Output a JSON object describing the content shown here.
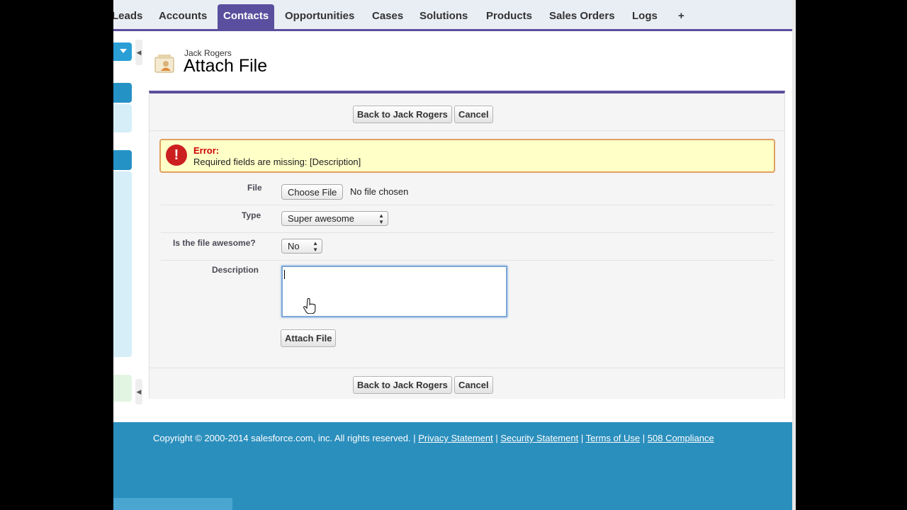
{
  "tabs": [
    {
      "label": "Leads",
      "active": false
    },
    {
      "label": "Accounts",
      "active": false
    },
    {
      "label": "Contacts",
      "active": true
    },
    {
      "label": "Opportunities",
      "active": false
    },
    {
      "label": "Cases",
      "active": false
    },
    {
      "label": "Solutions",
      "active": false
    },
    {
      "label": "Products",
      "active": false
    },
    {
      "label": "Sales Orders",
      "active": false
    },
    {
      "label": "Logs",
      "active": false
    },
    {
      "label": "+",
      "active": false
    }
  ],
  "header": {
    "record_name": "Jack Rogers",
    "title": "Attach File"
  },
  "buttons": {
    "back_label": "Back to Jack Rogers",
    "cancel_label": "Cancel",
    "attach_label": "Attach File"
  },
  "error": {
    "title": "Error:",
    "message": "Required fields are missing: [Description]"
  },
  "form": {
    "file_label": "File",
    "choose_file_label": "Choose File",
    "file_status": "No file chosen",
    "type_label": "Type",
    "type_value": "Super awesome",
    "awesome_label": "Is the file awesome?",
    "awesome_value": "No",
    "description_label": "Description",
    "description_value": ""
  },
  "footer": {
    "copyright": "Copyright © 2000-2014 salesforce.com, inc. All rights reserved. |",
    "links": [
      "Privacy Statement",
      "Security Statement",
      "Terms of Use",
      "508 Compliance"
    ]
  },
  "colors": {
    "tab_accent": "#5a4f9e",
    "footer_bg": "#2b8fbd",
    "error_bg": "#ffffc8",
    "error_title": "#cc0000"
  }
}
